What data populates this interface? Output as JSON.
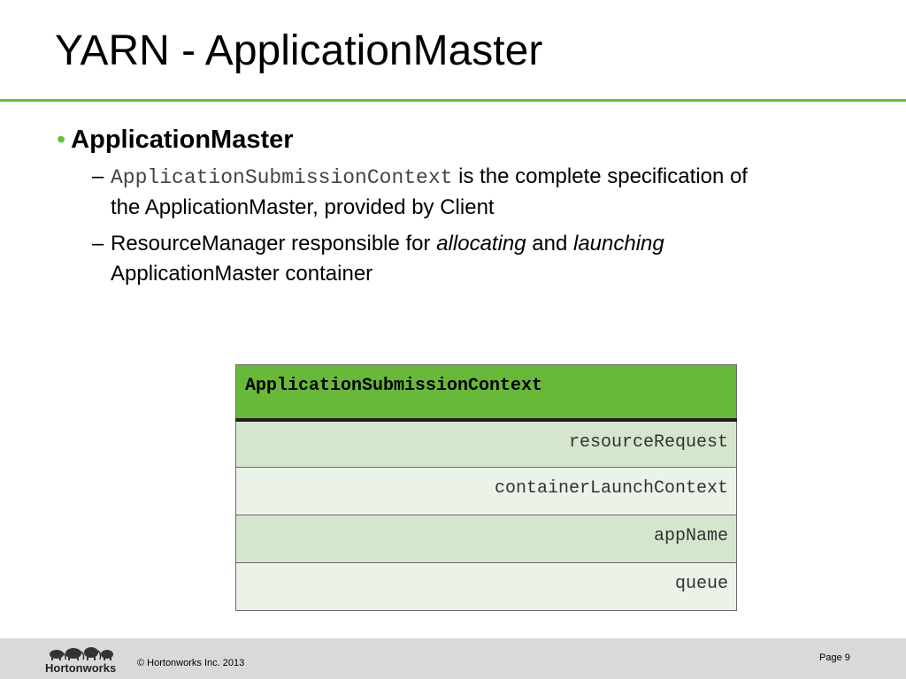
{
  "slide": {
    "title": "YARN - ApplicationMaster",
    "accent_color": "#6abf3b"
  },
  "content": {
    "bullet": "ApplicationMaster",
    "subs": [
      {
        "code": "ApplicationSubmissionContext",
        "text_after_code": " is the complete specification of the ApplicationMaster, provided by Client"
      },
      {
        "text_before": "ResourceManager responsible for ",
        "em1": "allocating",
        "text_mid": " and ",
        "em2": "launching",
        "text_after": " ApplicationMaster container"
      }
    ]
  },
  "table": {
    "header": "ApplicationSubmissionContext",
    "rows": [
      "resourceRequest",
      "containerLaunchContext",
      "appName",
      "queue"
    ],
    "header_color": "#68b93a",
    "row_colors": [
      "#d6e6ce",
      "#ebf2e8"
    ]
  },
  "footer": {
    "logo_text": "Hortonworks",
    "copyright": "© Hortonworks Inc. 2013",
    "page": "Page 9",
    "logo_icon": "elephants-icon"
  }
}
